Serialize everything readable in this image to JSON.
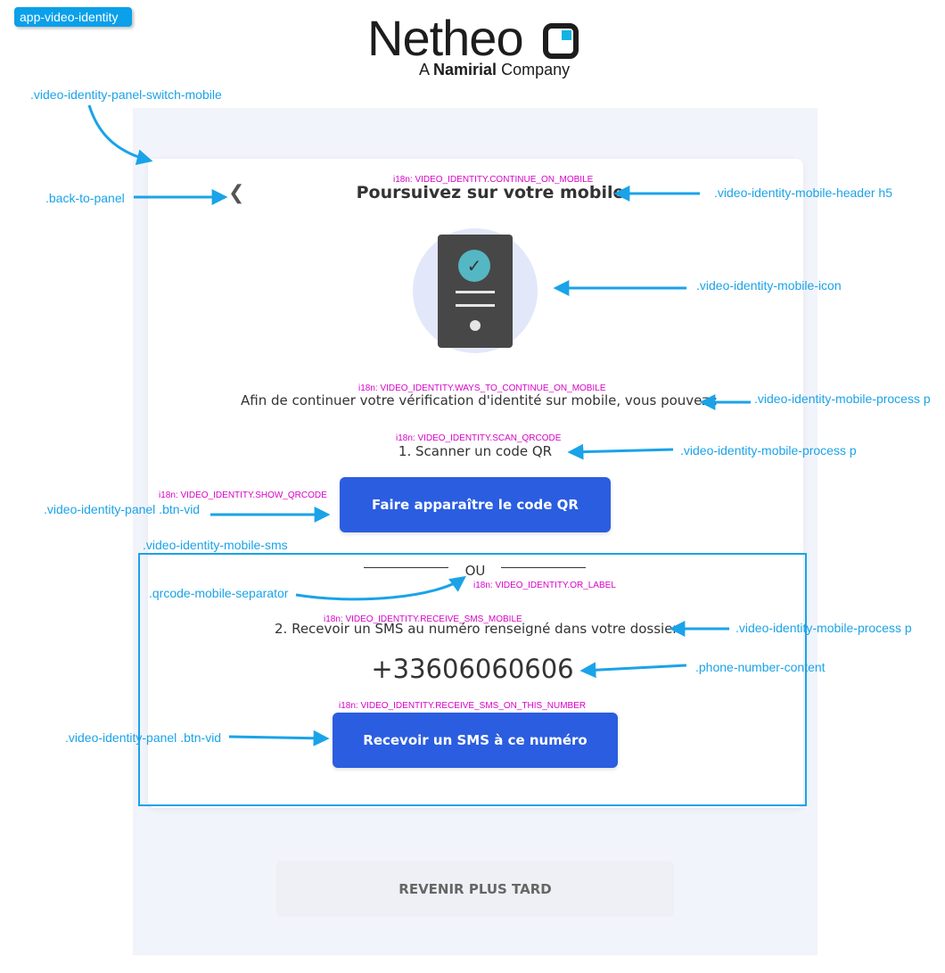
{
  "app_badge": "app-video-identity",
  "logo": {
    "main_text": "Nethe",
    "accent_text": "o",
    "sub_prefix": "A ",
    "sub_brand": "Namirial",
    "sub_suffix": " Company"
  },
  "colors": {
    "primary": "#2b5de1",
    "annotation": "#1aa3e8",
    "i18n": "#d900c8",
    "panel_bg": "#f2f4fb"
  },
  "header": {
    "back_icon": "chevron-left-icon",
    "title": "Poursuivez sur votre mobile",
    "i18n_key": "i18n: VIDEO_IDENTITY.CONTINUE_ON_MOBILE"
  },
  "mobile_icon": {
    "icon": "phone-check-icon",
    "check": "✓"
  },
  "process": {
    "ways_key": "i18n: VIDEO_IDENTITY.WAYS_TO_CONTINUE_ON_MOBILE",
    "ways_text": "Afin de continuer votre vérification d'identité sur mobile, vous pouvez :",
    "scan_key": "i18n: VIDEO_IDENTITY.SCAN_QRCODE",
    "scan_text": "1. Scanner un code QR",
    "show_qr_key": "i18n: VIDEO_IDENTITY.SHOW_QRCODE",
    "show_qr_label": "Faire apparaître le code QR"
  },
  "sms": {
    "or_label": "OU",
    "or_key": "i18n: VIDEO_IDENTITY.OR_LABEL",
    "receive_key": "i18n: VIDEO_IDENTITY.RECEIVE_SMS_MOBILE",
    "receive_text": "2. Recevoir un SMS au numéro renseigné dans votre dossier",
    "phone_number": "+33606060606",
    "button_key": "i18n: VIDEO_IDENTITY.RECEIVE_SMS_ON_THIS_NUMBER",
    "button_label": "Recevoir un SMS à ce numéro"
  },
  "later_button": "REVENIR PLUS TARD",
  "annotations": {
    "panel_switch": ".video-identity-panel-switch-mobile",
    "back_to_panel": ".back-to-panel",
    "header_h5": ".video-identity-mobile-header h5",
    "mobile_icon": ".video-identity-mobile-icon",
    "process_p_1": ".video-identity-mobile-process p",
    "process_p_2": ".video-identity-mobile-process p",
    "panel_btn_1": ".video-identity-panel .btn-vid",
    "mobile_sms": ".video-identity-mobile-sms",
    "separator": ".qrcode-mobile-separator",
    "process_p_3": ".video-identity-mobile-process p",
    "phone_content": ".phone-number-content",
    "panel_btn_2": ".video-identity-panel .btn-vid"
  }
}
